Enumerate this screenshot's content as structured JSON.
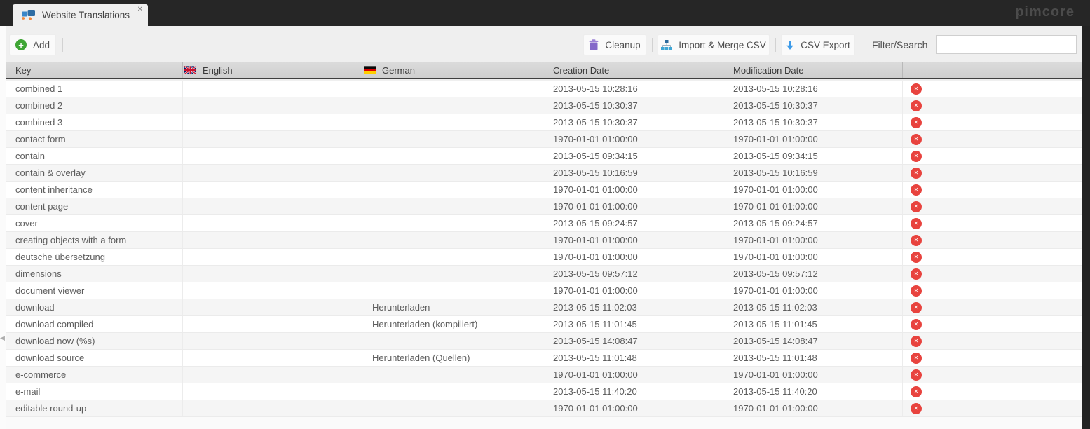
{
  "topbar": {
    "tab_label": "Website Translations",
    "logo": "pimcore"
  },
  "toolbar": {
    "add_label": "Add",
    "cleanup_label": "Cleanup",
    "import_label": "Import & Merge CSV",
    "export_label": "CSV Export",
    "filter_label": "Filter/Search",
    "filter_value": ""
  },
  "icons": {
    "tab": "translations-icon",
    "add_glyph": "+",
    "close_glyph": "✕",
    "delete_glyph": "✕",
    "collapse_glyph": "◀"
  },
  "colors": {
    "topbar_bg": "#262626",
    "panel_bg": "#efefef",
    "accent_green": "#3fa535",
    "accent_red": "#e8433e",
    "accent_purple": "#8468c9",
    "accent_blue": "#3d9be9",
    "header_border": "#3f3f3f",
    "row_alt": "#f5f5f5"
  },
  "grid": {
    "columns": {
      "key": "Key",
      "english": "English",
      "german": "German",
      "creation": "Creation Date",
      "modification": "Modification Date"
    },
    "rows": [
      {
        "key": "combined 1",
        "english": "",
        "german": "",
        "creation": "2013-05-15 10:28:16",
        "modification": "2013-05-15 10:28:16"
      },
      {
        "key": "combined 2",
        "english": "",
        "german": "",
        "creation": "2013-05-15 10:30:37",
        "modification": "2013-05-15 10:30:37"
      },
      {
        "key": "combined 3",
        "english": "",
        "german": "",
        "creation": "2013-05-15 10:30:37",
        "modification": "2013-05-15 10:30:37"
      },
      {
        "key": "contact form",
        "english": "",
        "german": "",
        "creation": "1970-01-01 01:00:00",
        "modification": "1970-01-01 01:00:00"
      },
      {
        "key": "contain",
        "english": "",
        "german": "",
        "creation": "2013-05-15 09:34:15",
        "modification": "2013-05-15 09:34:15"
      },
      {
        "key": "contain & overlay",
        "english": "",
        "german": "",
        "creation": "2013-05-15 10:16:59",
        "modification": "2013-05-15 10:16:59"
      },
      {
        "key": "content inheritance",
        "english": "",
        "german": "",
        "creation": "1970-01-01 01:00:00",
        "modification": "1970-01-01 01:00:00"
      },
      {
        "key": "content page",
        "english": "",
        "german": "",
        "creation": "1970-01-01 01:00:00",
        "modification": "1970-01-01 01:00:00"
      },
      {
        "key": "cover",
        "english": "",
        "german": "",
        "creation": "2013-05-15 09:24:57",
        "modification": "2013-05-15 09:24:57"
      },
      {
        "key": "creating objects with a form",
        "english": "",
        "german": "",
        "creation": "1970-01-01 01:00:00",
        "modification": "1970-01-01 01:00:00"
      },
      {
        "key": "deutsche übersetzung",
        "english": "",
        "german": "",
        "creation": "1970-01-01 01:00:00",
        "modification": "1970-01-01 01:00:00"
      },
      {
        "key": "dimensions",
        "english": "",
        "german": "",
        "creation": "2013-05-15 09:57:12",
        "modification": "2013-05-15 09:57:12"
      },
      {
        "key": "document viewer",
        "english": "",
        "german": "",
        "creation": "1970-01-01 01:00:00",
        "modification": "1970-01-01 01:00:00"
      },
      {
        "key": "download",
        "english": "",
        "german": "Herunterladen",
        "creation": "2013-05-15 11:02:03",
        "modification": "2013-05-15 11:02:03"
      },
      {
        "key": "download compiled",
        "english": "",
        "german": "Herunterladen (kompiliert)",
        "creation": "2013-05-15 11:01:45",
        "modification": "2013-05-15 11:01:45"
      },
      {
        "key": "download now (%s)",
        "english": "",
        "german": "",
        "creation": "2013-05-15 14:08:47",
        "modification": "2013-05-15 14:08:47"
      },
      {
        "key": "download source",
        "english": "",
        "german": "Herunterladen (Quellen)",
        "creation": "2013-05-15 11:01:48",
        "modification": "2013-05-15 11:01:48"
      },
      {
        "key": "e-commerce",
        "english": "",
        "german": "",
        "creation": "1970-01-01 01:00:00",
        "modification": "1970-01-01 01:00:00"
      },
      {
        "key": "e-mail",
        "english": "",
        "german": "",
        "creation": "2013-05-15 11:40:20",
        "modification": "2013-05-15 11:40:20"
      },
      {
        "key": "editable round-up",
        "english": "",
        "german": "",
        "creation": "1970-01-01 01:00:00",
        "modification": "1970-01-01 01:00:00"
      }
    ]
  }
}
